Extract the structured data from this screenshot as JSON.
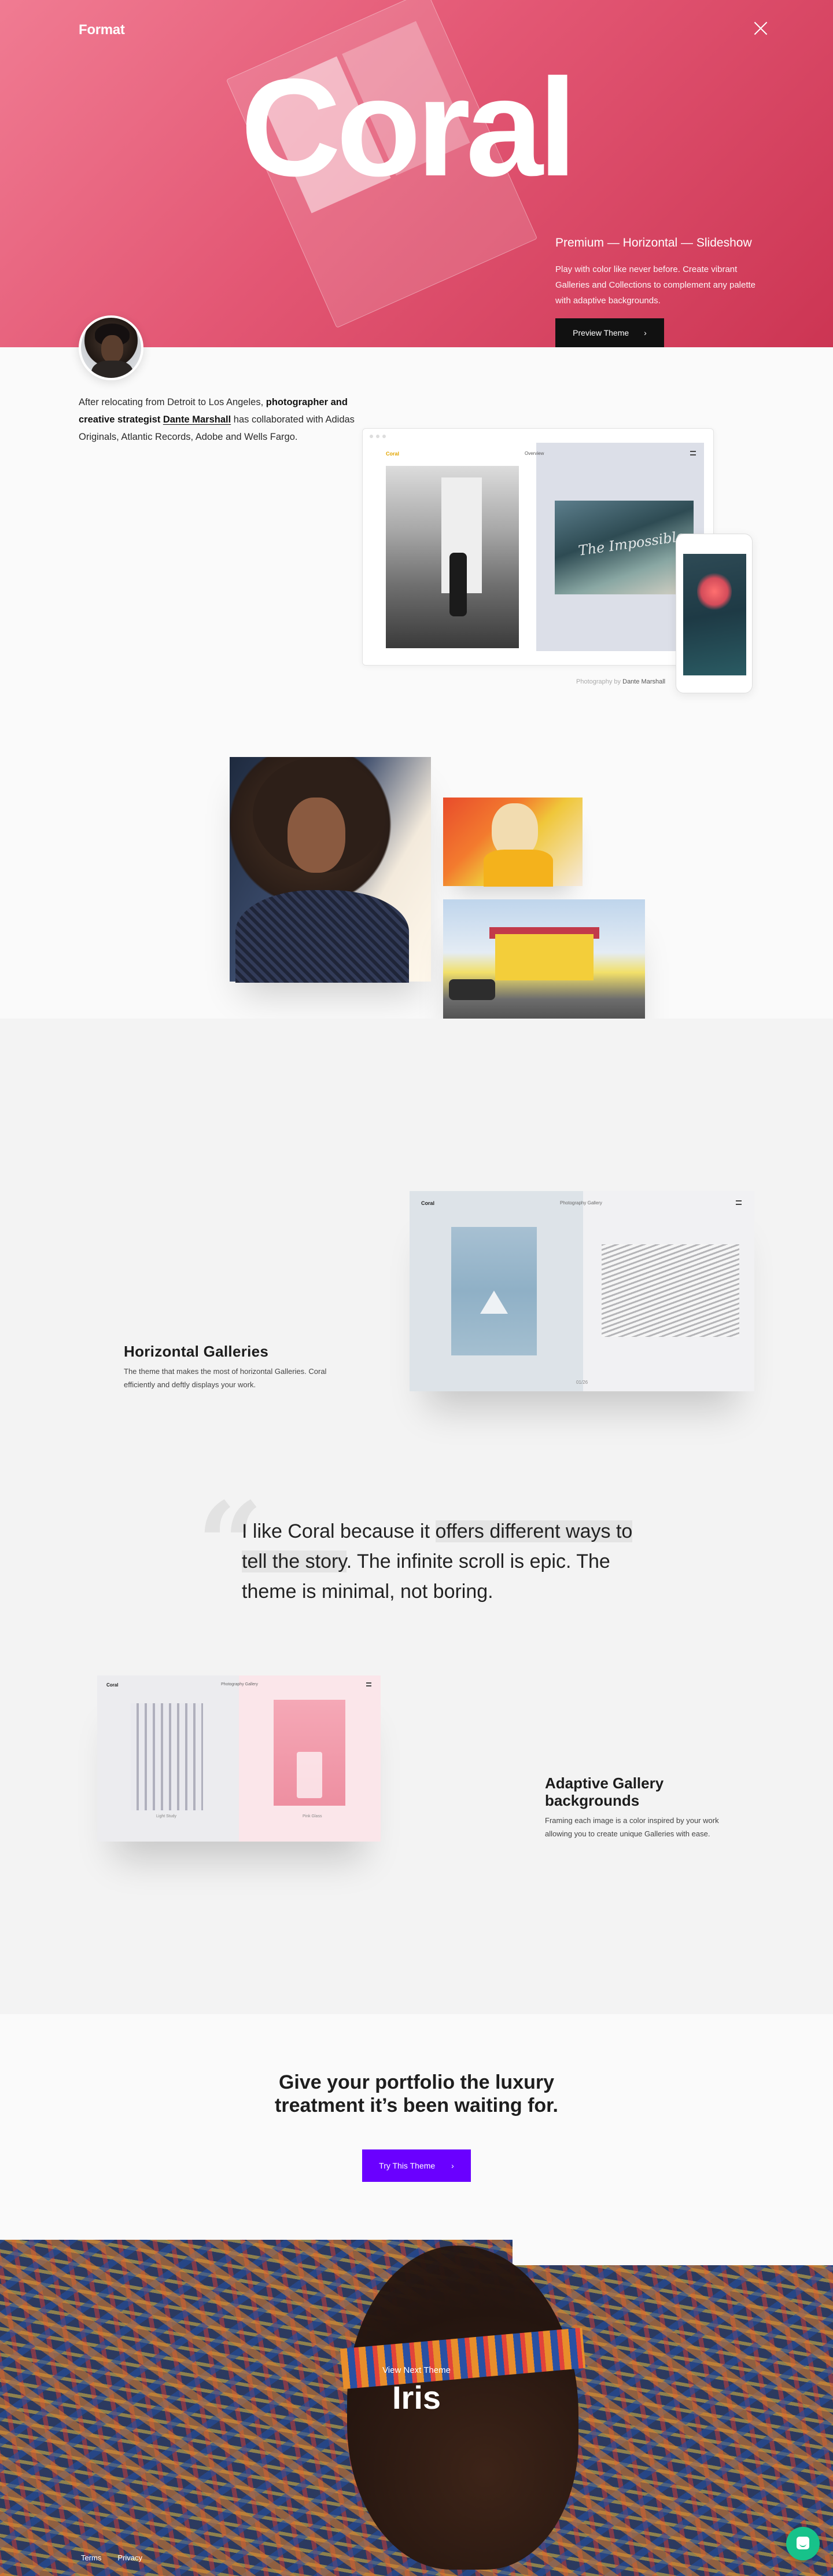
{
  "header": {
    "logo": "Format",
    "close_label": "×"
  },
  "hero": {
    "title": "Coral",
    "meta": "Premium — Horizontal — Slideshow",
    "description": "Play with color like never before. Create vibrant Galleries and Collections to complement any palette with adaptive backgrounds.",
    "preview_button": "Preview Theme",
    "preview_arrow": "›",
    "background_color": "#e35774"
  },
  "intro": {
    "part1": "After relocating from Detroit to Los Angeles, ",
    "bold1": "photographer and creative strategist ",
    "name": "Dante Marshall",
    "part2": " has collaborated with Adidas Originals, Atlantic Records, Adobe and Wells Fargo."
  },
  "mockup": {
    "left_tag": "Coral",
    "right_nav": "Overview",
    "image_text": "The Impossible",
    "credit_prefix": "Photography by ",
    "credit_name": "Dante Marshall"
  },
  "horizontal_galleries": {
    "title": "Horizontal Galleries",
    "description": "The theme that makes the most of horizontal Galleries. Coral efficiently and deftly displays your work.",
    "brand": "Coral",
    "nav": "Photography Gallery",
    "caption": "01/26"
  },
  "quote": {
    "mark": "“",
    "part1": "I like Coral because it ",
    "highlight1": "offers different ways to tell the story",
    "part2": ". The infinite scroll is epic. The theme is minimal, not boring."
  },
  "adaptive": {
    "title": "Adaptive Gallery backgrounds",
    "description": "Framing each image is a color inspired by your work allowing you to create unique Galleries with ease.",
    "brand": "Coral",
    "nav": "Photography Gallery",
    "cap_left": "Light Study",
    "cap_right": "Pink Glass"
  },
  "cta": {
    "title_line1": "Give your portfolio the luxury",
    "title_line2": "treatment it’s been waiting for.",
    "button": "Try This Theme",
    "arrow": "›",
    "button_color": "#6a00ff"
  },
  "next_theme": {
    "subtitle": "View Next Theme",
    "title": "Iris"
  },
  "footer": {
    "links": [
      "Terms",
      "Privacy"
    ]
  },
  "chat": {
    "icon": "chat-bubble-icon",
    "color": "#17c28a"
  }
}
